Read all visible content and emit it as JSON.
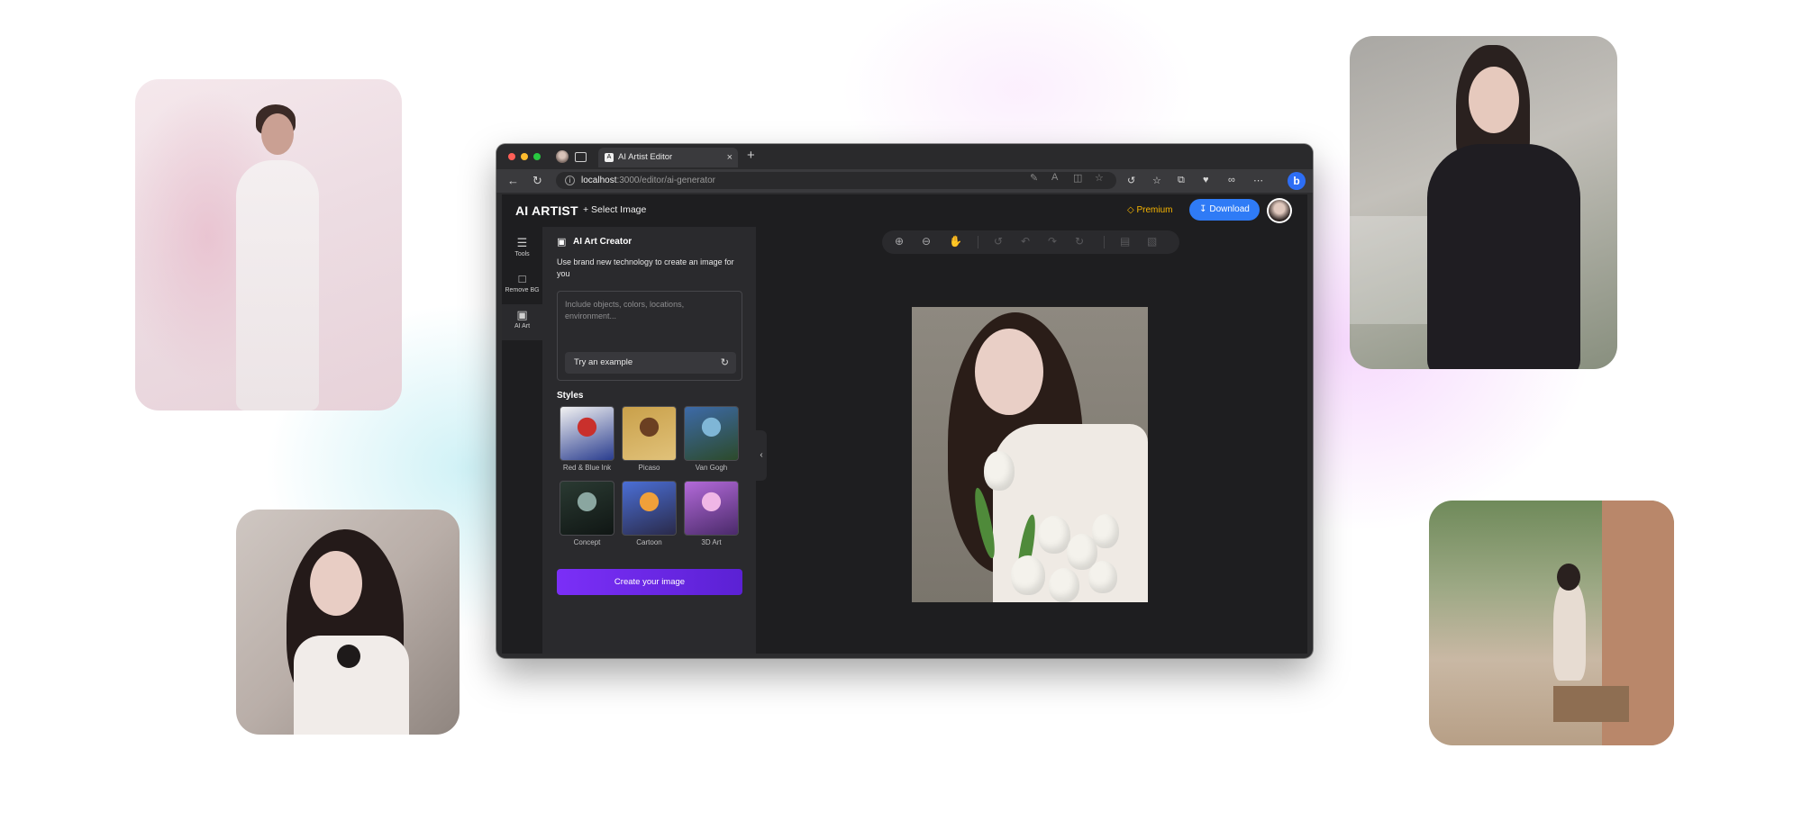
{
  "browser": {
    "tab_title": "AI Artist Editor",
    "tab_favicon": "A",
    "tab_close": "×",
    "new_tab": "+",
    "url_host": "localhost",
    "url_path": ":3000/editor/ai-generator",
    "bing_label": "b"
  },
  "app": {
    "brand": "AI ARTIST",
    "select_image": "+ Select Image",
    "premium": "Premium",
    "download": "Download"
  },
  "rail": [
    {
      "label": "Tools",
      "icon": "sliders-icon"
    },
    {
      "label": "Remove BG",
      "icon": "crop-icon"
    },
    {
      "label": "AI Art",
      "icon": "image-icon"
    }
  ],
  "panel": {
    "title": "AI Art Creator",
    "description": "Use brand new technology to create an image for you",
    "prompt_placeholder": "Include objects, colors, locations, environment...",
    "try_example": "Try an example",
    "styles_heading": "Styles",
    "styles": [
      {
        "label": "Red & Blue Ink",
        "colors": [
          "#f2f2f2",
          "#c9302c",
          "#2a3d8f"
        ]
      },
      {
        "label": "Picaso",
        "colors": [
          "#c9a04a",
          "#6b3f22",
          "#e1c27a"
        ]
      },
      {
        "label": "Van Gogh",
        "colors": [
          "#3d6aa8",
          "#7fb6d6",
          "#2c4a2a"
        ]
      },
      {
        "label": "Concept",
        "colors": [
          "#2a3a32",
          "#8aa6a0",
          "#101614"
        ]
      },
      {
        "label": "Cartoon",
        "colors": [
          "#4b6fd6",
          "#f0a03a",
          "#2a2a4a"
        ]
      },
      {
        "label": "3D Art",
        "colors": [
          "#b36ad9",
          "#f0b6e6",
          "#4a2a6a"
        ]
      }
    ],
    "create_button": "Create your image"
  },
  "colors": {
    "accent_download": "#2f7bf6",
    "accent_premium": "#f7b500",
    "create_gradient_start": "#7b2ff7",
    "create_gradient_end": "#5b21d4"
  }
}
